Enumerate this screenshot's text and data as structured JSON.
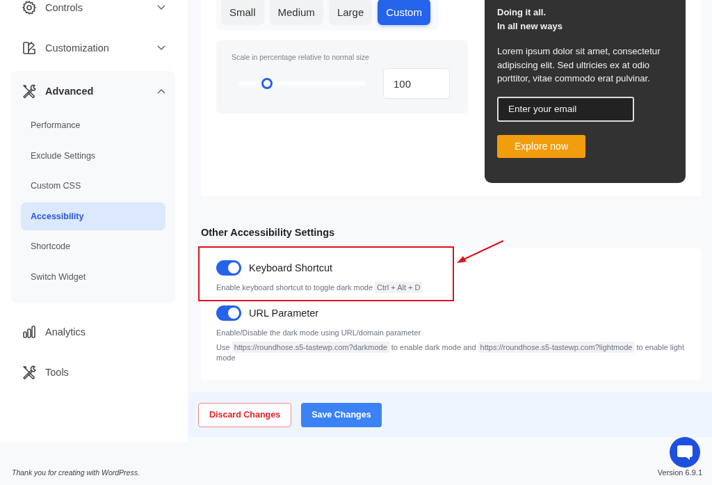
{
  "sidebar": {
    "items": [
      {
        "label": "Controls",
        "kind": "gear",
        "expanded": false
      },
      {
        "label": "Customization",
        "kind": "palette",
        "expanded": false
      },
      {
        "label": "Advanced",
        "kind": "tools",
        "expanded": true,
        "children": [
          {
            "label": "Performance",
            "selected": false
          },
          {
            "label": "Exclude Settings",
            "selected": false
          },
          {
            "label": "Custom CSS",
            "selected": false
          },
          {
            "label": "Accessibility",
            "selected": true
          },
          {
            "label": "Shortcode",
            "selected": false
          },
          {
            "label": "Switch Widget",
            "selected": false
          }
        ]
      },
      {
        "label": "Analytics",
        "kind": "chart"
      },
      {
        "label": "Tools",
        "kind": "tools"
      }
    ]
  },
  "size_presets": [
    {
      "label": "Small",
      "selected": false
    },
    {
      "label": "Medium",
      "selected": false
    },
    {
      "label": "Large",
      "selected": false
    },
    {
      "label": "Custom",
      "selected": true
    }
  ],
  "scale": {
    "label": "Scale in percentage relative to normal size",
    "level": 0.22,
    "value": "100"
  },
  "promo": {
    "heading": [
      "Doing it all.",
      "In all new ways"
    ],
    "body": "Lorem ipsum dolor sit amet, consectetur adipiscing elit. Sed ultricies ex at odio porttitor, vitae commodo erat pulvinar.",
    "email_placeholder": "Enter your email",
    "button": "Explore now"
  },
  "section_title": "Other Accessibility Settings",
  "settings": [
    {
      "label": "Keyboard Shortcut",
      "on": true,
      "highlighted": true,
      "notes": [
        [
          {
            "kind": "plain",
            "text": "Enable keyboard shortcut to toggle dark mode "
          },
          {
            "kind": "code",
            "text": "Ctrl + Alt + D"
          }
        ]
      ]
    },
    {
      "label": "URL Parameter",
      "on": true,
      "highlighted": false,
      "notes": [
        [
          {
            "kind": "plain",
            "text": "Enable/Disable the dark mode using URL/domain parameter"
          }
        ],
        [
          {
            "kind": "plain",
            "text": "Use "
          },
          {
            "kind": "code",
            "text": "https://roundhose.s5-tastewp.com?darkmode"
          },
          {
            "kind": "plain",
            "text": " to enable dark mode and "
          },
          {
            "kind": "code",
            "text": "https://roundhose.s5-tastewp.com?lightmode"
          },
          {
            "kind": "plain",
            "text": " to enable light mode"
          }
        ]
      ]
    }
  ],
  "actions": [
    {
      "label": "Discard Changes",
      "kind": "secondary"
    },
    {
      "label": "Save Changes",
      "kind": "primary"
    }
  ],
  "footer": {
    "credit": "Thank you for creating with WordPress.",
    "version": "Version 6.9.1"
  }
}
